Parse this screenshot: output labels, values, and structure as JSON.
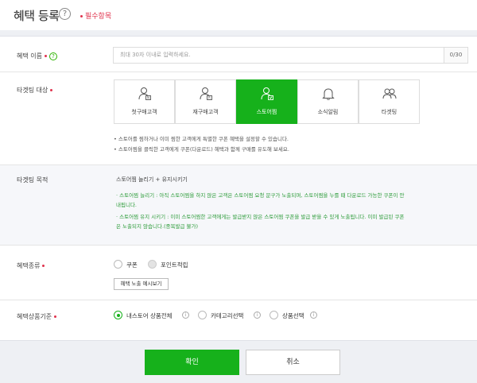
{
  "header": {
    "title": "혜택 등록",
    "help_icon": "?",
    "required_note": "필수항목"
  },
  "benefit_name": {
    "label": "혜택 이름",
    "help_icon": "?",
    "placeholder": "최대 30자 이내로 입력하세요.",
    "counter": "0/30"
  },
  "targeting": {
    "label": "타겟팅 대상",
    "options": [
      {
        "label": "첫구매고객",
        "icon": "person-new-icon",
        "selected": false
      },
      {
        "label": "재구매고객",
        "icon": "person-return-icon",
        "selected": false
      },
      {
        "label": "스토어찜",
        "icon": "person-store-icon",
        "selected": true
      },
      {
        "label": "소식알림",
        "icon": "bell-icon",
        "selected": false
      },
      {
        "label": "타겟팅",
        "icon": "people-icon",
        "selected": false
      }
    ],
    "notes": [
      "• 스토어를 찜하거나 이미 찜한 고객에게 특별한 쿠폰 혜택을 설정할 수 있습니다.",
      "• 스토어찜을 클릭한 고객에게 쿠폰(다운로드) 혜택과 함께 구매를 유도해 보세요."
    ]
  },
  "targeting_goal": {
    "label": "타겟팅 목적",
    "title": "스토어찜 늘리기 + 유지시키기",
    "lines": [
      "· 스토어찜 늘리기 : 아직 스토어찜을 하지 않은 고객은 스토어찜 요청 문구가 노출되며, 스토어찜을 누를 때 다운로드 가능한 쿠폰이 안",
      "내됩니다.",
      "· 스토어찜 유지 시키기 : 이미 스토어찜한 고객에게는 발급받지 않은 스토어찜 쿠폰을 발급 받을 수 있게 노출됩니다. 이미 발급된 쿠폰",
      "은 노출되지 않습니다.(중복발급 불가)"
    ]
  },
  "benefit_type": {
    "label": "혜택종류",
    "options": [
      {
        "label": "쿠폰"
      },
      {
        "label": "포인트적립"
      }
    ],
    "preview_button": "혜택 노출 예시보기"
  },
  "product_criteria": {
    "label": "혜택상품기준",
    "options": [
      {
        "label": "내스토어 상품전체",
        "selected": true
      },
      {
        "label": "카테고리선택",
        "selected": false
      },
      {
        "label": "상품선택",
        "selected": false
      }
    ],
    "info_icon": "i"
  },
  "footer": {
    "confirm": "확인",
    "cancel": "취소"
  },
  "colors": {
    "accent": "#16b11b",
    "required": "#e0334d",
    "goal_text": "#2b9b38"
  }
}
